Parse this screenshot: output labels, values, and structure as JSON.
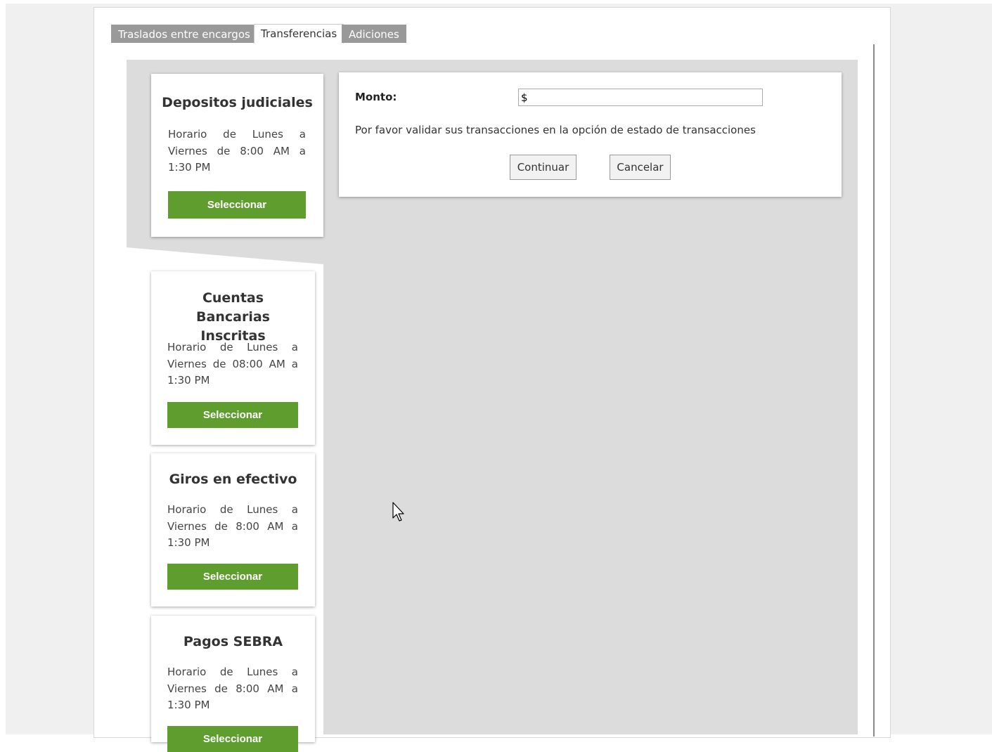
{
  "tabs": [
    {
      "label": "Traslados entre encargos",
      "active": false
    },
    {
      "label": "Transferencias",
      "active": true
    },
    {
      "label": "Adiciones",
      "active": false
    }
  ],
  "cards": [
    {
      "title": "Depositos judiciales",
      "schedule": "Horario de Lunes a Viernes de 8:00 AM a 1:30 PM",
      "button": "Seleccionar"
    },
    {
      "title": "Cuentas Bancarias Inscritas",
      "schedule": "Horario de Lunes a Viernes de 08:00 AM a 1:30 PM",
      "button": "Seleccionar"
    },
    {
      "title": "Giros en efectivo",
      "schedule": "Horario de Lunes a Viernes de 8:00 AM a 1:30 PM",
      "button": "Seleccionar"
    },
    {
      "title": "Pagos SEBRA",
      "schedule": "Horario de Lunes a Viernes de 8:00 AM a 1:30 PM",
      "button": "Seleccionar"
    }
  ],
  "form": {
    "amount_label": "Monto:",
    "amount_value": "$",
    "note": "Por favor validar sus transacciones en la opción de estado de transacciones",
    "continue_label": "Continuar",
    "cancel_label": "Cancelar"
  },
  "colors": {
    "accent_green": "#5f9e2e",
    "tab_inactive": "#999999",
    "content_bg": "#dcdcdc"
  },
  "icons": {
    "cursor": "arrow-pointer"
  }
}
